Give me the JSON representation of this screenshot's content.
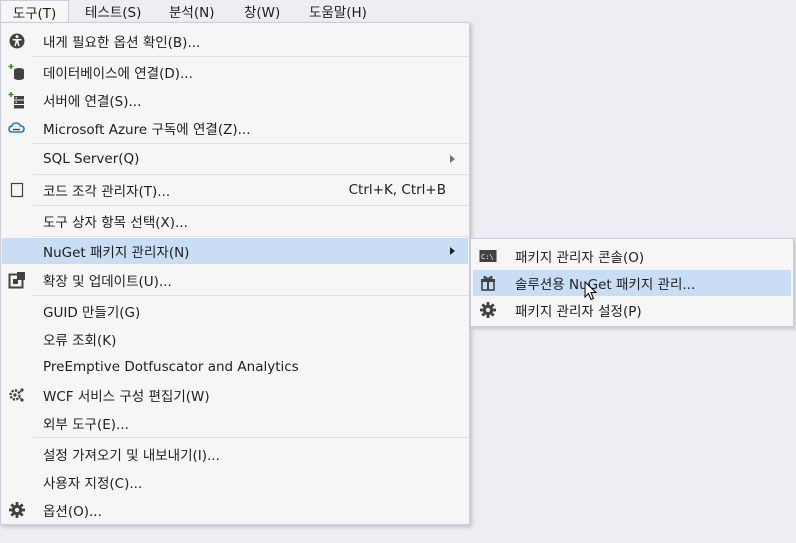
{
  "menubar": {
    "items": [
      "도구(T)",
      "테스트(S)",
      "분석(N)",
      "창(W)",
      "도움말(H)"
    ]
  },
  "tools_menu": {
    "items": [
      {
        "label": "내게 필요한 옵션 확인(B)...",
        "icon": "accessibility-icon"
      },
      {
        "label": "데이터베이스에 연결(D)...",
        "icon": "database-connect-icon"
      },
      {
        "label": "서버에 연결(S)...",
        "icon": "server-connect-icon"
      },
      {
        "label": "Microsoft Azure 구독에 연결(Z)...",
        "icon": "azure-cloud-icon"
      },
      {
        "label": "SQL Server(Q)",
        "submenu": true
      },
      {
        "label": "코드 조각 관리자(T)...",
        "shortcut": "Ctrl+K, Ctrl+B",
        "icon": "snippet-icon"
      },
      {
        "label": "도구 상자 항목 선택(X)..."
      },
      {
        "label": "NuGet 패키지 관리자(N)",
        "submenu": true,
        "highlighted": true
      },
      {
        "label": "확장 및 업데이트(U)...",
        "icon": "extensions-icon"
      },
      {
        "label": "GUID 만들기(G)"
      },
      {
        "label": "오류 조회(K)"
      },
      {
        "label": "PreEmptive Dotfuscator and Analytics"
      },
      {
        "label": "WCF 서비스 구성 편집기(W)",
        "icon": "wcf-config-icon"
      },
      {
        "label": "외부 도구(E)..."
      },
      {
        "label": "설정 가져오기 및 내보내기(I)..."
      },
      {
        "label": "사용자 지정(C)..."
      },
      {
        "label": "옵션(O)...",
        "icon": "gear-icon"
      }
    ]
  },
  "nuget_submenu": {
    "items": [
      {
        "label": "패키지 관리자 콘솔(O)",
        "icon": "console-icon"
      },
      {
        "label": "솔루션용 NuGet 패키지 관리...",
        "icon": "package-icon",
        "highlighted": true
      },
      {
        "label": "패키지 관리자 설정(P)",
        "icon": "gear-icon"
      }
    ]
  },
  "colors": {
    "menu_bg": "#f6f6f6",
    "highlight": "#c9def5",
    "border": "#cccedb",
    "icon_green": "#388a34"
  }
}
